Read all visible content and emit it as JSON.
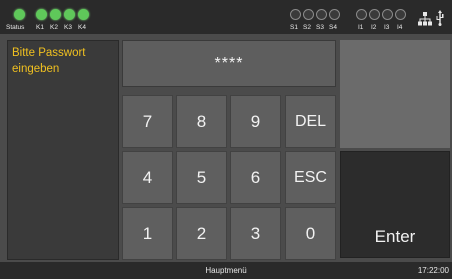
{
  "status_bar": {
    "status_label": "Status",
    "k_labels": [
      "K1",
      "K2",
      "K3",
      "K4"
    ],
    "s_labels": [
      "S1",
      "S2",
      "S3",
      "S4"
    ],
    "i_labels": [
      "I1",
      "I2",
      "I3",
      "I4"
    ],
    "status_led": "on",
    "k_leds": [
      "on",
      "on",
      "on",
      "on"
    ],
    "s_leds": [
      "off",
      "off",
      "off",
      "off"
    ],
    "i_leds": [
      "off",
      "off",
      "off",
      "off"
    ],
    "icons": [
      "network-icon",
      "usb-icon"
    ]
  },
  "prompt": {
    "text": "Bitte Passwort eingeben"
  },
  "password": {
    "masked_value": "****"
  },
  "keypad": {
    "row1": [
      "7",
      "8",
      "9",
      "DEL"
    ],
    "row2": [
      "4",
      "5",
      "6",
      "ESC"
    ],
    "row3": [
      "1",
      "2",
      "3",
      "0"
    ],
    "enter": "Enter"
  },
  "bottom_bar": {
    "menu_label": "Hauptmenü",
    "time": "17:22:00"
  },
  "colors": {
    "accent_text": "#f0c020",
    "led_on": "#5fc85a",
    "background": "#4b4b4b",
    "bar": "#2a2a2a"
  }
}
